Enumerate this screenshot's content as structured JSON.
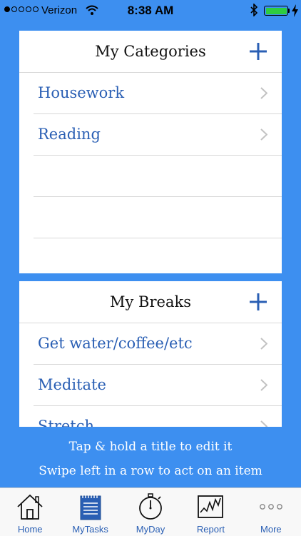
{
  "status": {
    "carrier": "Verizon",
    "time": "8:38 AM",
    "battery_color": "#2ecc40"
  },
  "categories": {
    "title": "My Categories",
    "add_icon": "plus-icon",
    "items": [
      {
        "label": "Housework"
      },
      {
        "label": "Reading"
      },
      {
        "label": ""
      },
      {
        "label": ""
      }
    ]
  },
  "breaks": {
    "title": "My Breaks",
    "add_icon": "plus-icon",
    "items": [
      {
        "label": "Get water/coffee/etc"
      },
      {
        "label": "Meditate"
      },
      {
        "label": "Stretch"
      }
    ]
  },
  "hints": {
    "line1": "Tap & hold a title to edit it",
    "line2": "Swipe left in a row to act on an item"
  },
  "tabs": [
    {
      "label": "Home",
      "icon": "house-icon"
    },
    {
      "label": "MyTasks",
      "icon": "notepad-icon",
      "selected": true
    },
    {
      "label": "MyDay",
      "icon": "stopwatch-icon"
    },
    {
      "label": "Report",
      "icon": "chart-icon"
    },
    {
      "label": "More",
      "icon": "more-icon"
    }
  ],
  "colors": {
    "background": "#3d8ff0",
    "accent": "#2a5fb4"
  }
}
